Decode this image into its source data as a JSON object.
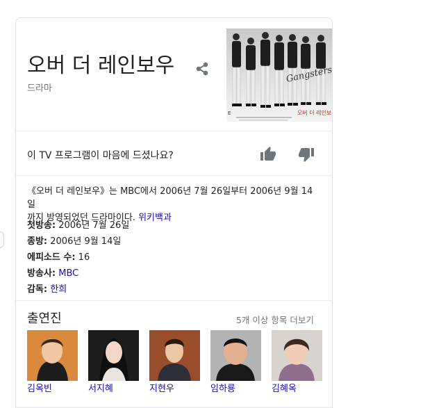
{
  "title": "오버 더 레인보우",
  "subtitle": "드라마",
  "poster": {
    "brand": "Gangsters",
    "logo_text": "오버 더 레인보우",
    "corner_mark": "E"
  },
  "feedback": {
    "question": "이 TV 프로그램이 마음에 드셨나요?"
  },
  "description": {
    "text_line1": "《오버 더 레인보우》는 MBC에서 2006년 7월 26일부터 2006년 9월 14일",
    "text_line2": "까지 방영되었던 드라마이다.",
    "link": "위키백과"
  },
  "facts": [
    {
      "label": "첫방송:",
      "value": "2006년 7월 26일"
    },
    {
      "label": "종방:",
      "value": "2006년 9월 14일"
    },
    {
      "label": "에피소드 수:",
      "value": "16"
    },
    {
      "label": "방송사:",
      "value": "MBC"
    },
    {
      "label": "감독:",
      "value": "한희"
    }
  ],
  "cast": {
    "title": "출연진",
    "more": "5개 이상 항목 더보기",
    "members": [
      {
        "name": "김옥빈"
      },
      {
        "name": "서지혜"
      },
      {
        "name": "지현우"
      },
      {
        "name": "임하룡"
      },
      {
        "name": "김혜옥"
      }
    ]
  },
  "colors": {
    "link": "#1a0dab",
    "muted": "#70757a",
    "divider": "#ebebeb",
    "icon": "#70757a"
  }
}
